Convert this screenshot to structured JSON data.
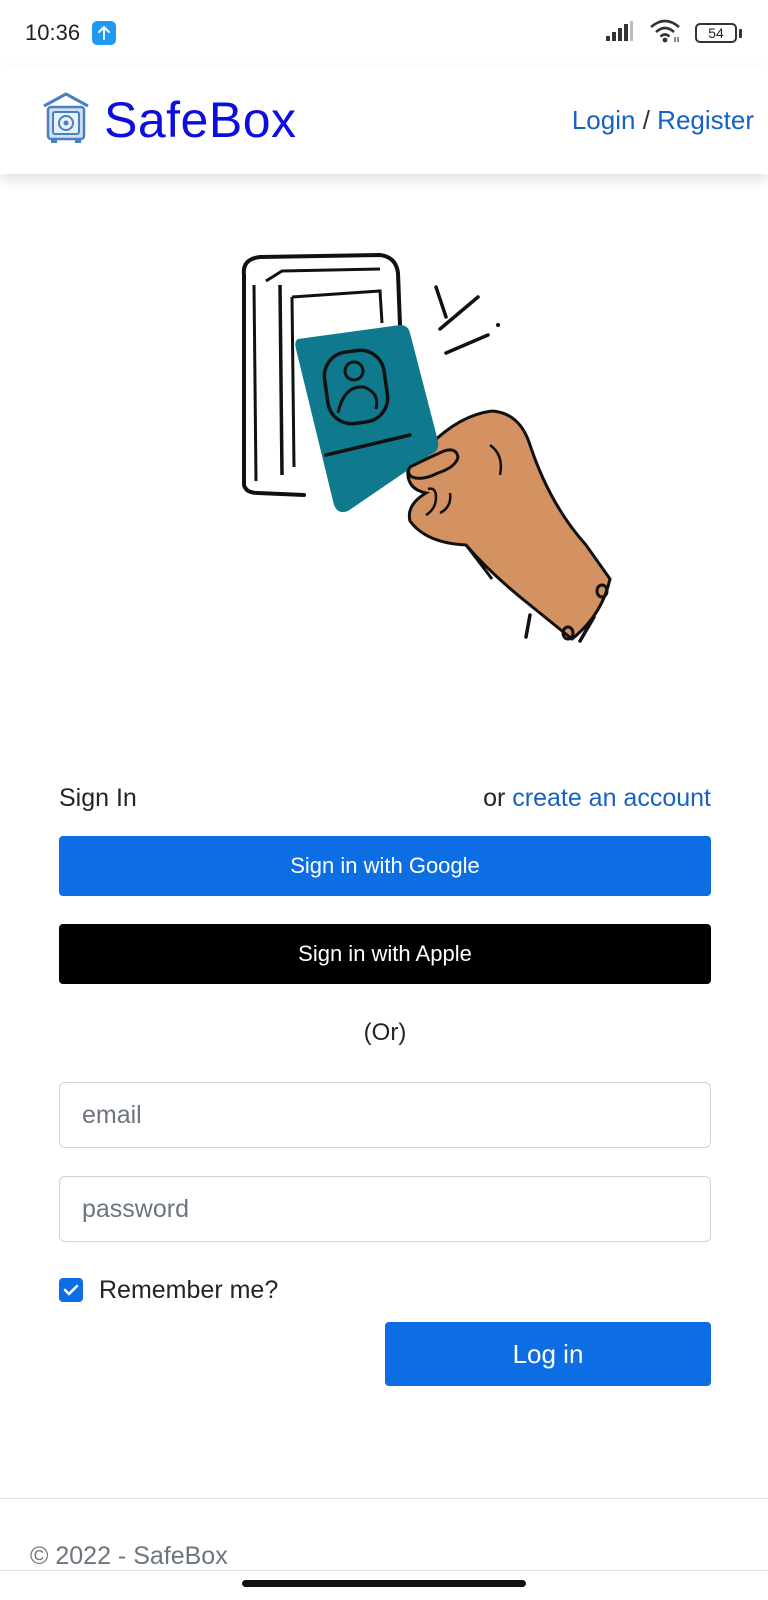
{
  "status_bar": {
    "time": "10:36",
    "battery": "54",
    "icons": [
      "upload-icon",
      "signal-icon",
      "wifi-icon",
      "battery-icon"
    ]
  },
  "header": {
    "brand": "SafeBox",
    "login_label": "Login",
    "separator": "/",
    "register_label": "Register"
  },
  "illustration": {
    "subject": "hand-holding-id-card-at-reader",
    "colors": {
      "card": "#0f7a8e",
      "skin": "#d49262",
      "line": "#111111"
    }
  },
  "sign_in": {
    "title": "Sign In",
    "or_text": "or",
    "create_account_label": "create an account",
    "google_button": "Sign in with Google",
    "apple_button": "Sign in with Apple",
    "separator": "(Or)",
    "email_placeholder": "email",
    "password_placeholder": "password",
    "remember_label": "Remember me?",
    "remember_checked": true,
    "login_button": "Log in"
  },
  "footer": {
    "copyright": "© 2022 - SafeBox"
  },
  "colors": {
    "brand": "#0d0de0",
    "link": "#1561c4",
    "primary": "#0d6ee3",
    "apple": "#000000"
  }
}
